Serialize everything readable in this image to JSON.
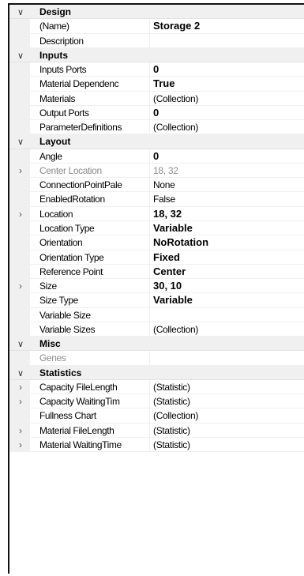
{
  "property_grid": {
    "sections": [
      {
        "label": "Design",
        "expanded": true,
        "rows": [
          {
            "name": "(Name)",
            "value": "Storage 2",
            "bold": true,
            "dim": false,
            "expandable": false
          },
          {
            "name": "Description",
            "value": "",
            "bold": false,
            "dim": false,
            "expandable": false
          }
        ]
      },
      {
        "label": "Inputs",
        "expanded": true,
        "rows": [
          {
            "name": "Inputs Ports",
            "value": "0",
            "bold": true,
            "dim": false,
            "expandable": false
          },
          {
            "name": "Material Dependenc",
            "value": "True",
            "bold": true,
            "dim": false,
            "expandable": false
          },
          {
            "name": "Materials",
            "value": "(Collection)",
            "bold": false,
            "dim": false,
            "expandable": false
          },
          {
            "name": "Output Ports",
            "value": "0",
            "bold": true,
            "dim": false,
            "expandable": false
          },
          {
            "name": "ParameterDefinitions",
            "value": "(Collection)",
            "bold": false,
            "dim": false,
            "expandable": false
          }
        ]
      },
      {
        "label": "Layout",
        "expanded": true,
        "rows": [
          {
            "name": "Angle",
            "value": "0",
            "bold": true,
            "dim": false,
            "expandable": false
          },
          {
            "name": "Center Location",
            "value": "18, 32",
            "bold": false,
            "dim": true,
            "expandable": true
          },
          {
            "name": "ConnectionPointPale",
            "value": "None",
            "bold": false,
            "dim": false,
            "expandable": false
          },
          {
            "name": "EnabledRotation",
            "value": "False",
            "bold": false,
            "dim": false,
            "expandable": false
          },
          {
            "name": "Location",
            "value": "18, 32",
            "bold": true,
            "dim": false,
            "expandable": true
          },
          {
            "name": "Location Type",
            "value": "Variable",
            "bold": true,
            "dim": false,
            "expandable": false
          },
          {
            "name": "Orientation",
            "value": "NoRotation",
            "bold": true,
            "dim": false,
            "expandable": false
          },
          {
            "name": "Orientation Type",
            "value": "Fixed",
            "bold": true,
            "dim": false,
            "expandable": false
          },
          {
            "name": "Reference Point",
            "value": "Center",
            "bold": true,
            "dim": false,
            "expandable": false
          },
          {
            "name": "Size",
            "value": "30, 10",
            "bold": true,
            "dim": false,
            "expandable": true
          },
          {
            "name": "Size Type",
            "value": "Variable",
            "bold": true,
            "dim": false,
            "expandable": false
          },
          {
            "name": "Variable Size",
            "value": "",
            "bold": false,
            "dim": false,
            "expandable": false
          },
          {
            "name": "Variable Sizes",
            "value": "(Collection)",
            "bold": false,
            "dim": false,
            "expandable": false
          }
        ]
      },
      {
        "label": "Misc",
        "expanded": true,
        "rows": [
          {
            "name": "Genes",
            "value": "",
            "bold": false,
            "dim": true,
            "expandable": false
          }
        ]
      },
      {
        "label": "Statistics",
        "expanded": true,
        "rows": [
          {
            "name": "Capacity FileLength",
            "value": "(Statistic)",
            "bold": false,
            "dim": false,
            "expandable": true
          },
          {
            "name": "Capacity WaitingTim",
            "value": "(Statistic)",
            "bold": false,
            "dim": false,
            "expandable": true
          },
          {
            "name": "Fullness Chart",
            "value": "(Collection)",
            "bold": false,
            "dim": false,
            "expandable": false
          },
          {
            "name": "Material FileLength",
            "value": "(Statistic)",
            "bold": false,
            "dim": false,
            "expandable": true
          },
          {
            "name": "Material WaitingTime",
            "value": "(Statistic)",
            "bold": false,
            "dim": false,
            "expandable": true
          }
        ]
      }
    ],
    "icons": {
      "collapse": "chevron-down-icon",
      "expand": "chevron-right-icon"
    }
  }
}
